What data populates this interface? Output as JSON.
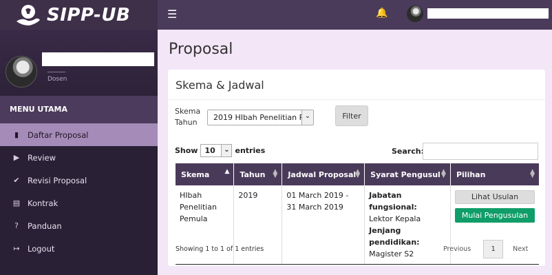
{
  "brand": {
    "name": "SIPP-UB",
    "logo_icon": "lightbulb-hand-icon"
  },
  "user": {
    "role": "Dosen"
  },
  "sidebar": {
    "menu_header": "MENU UTAMA",
    "items": [
      {
        "label": "Daftar Proposal",
        "icon": "book-icon",
        "active": true
      },
      {
        "label": "Review",
        "icon": "folder-open-icon"
      },
      {
        "label": "Revisi Proposal",
        "icon": "check-circle-icon"
      },
      {
        "label": "Kontrak",
        "icon": "file-icon"
      },
      {
        "label": "Panduan",
        "icon": "question-circle-icon"
      },
      {
        "label": "Logout",
        "icon": "sign-out-icon"
      }
    ]
  },
  "topbar": {
    "menu_icon": "hamburger-icon",
    "bell_icon": "bell-icon"
  },
  "page": {
    "title": "Proposal"
  },
  "panel": {
    "title": "Skema & Jadwal",
    "skema_label_line1": "Skema",
    "skema_label_line2": "Tahun",
    "skema_selected": "2019 HIbah Penelitian Pe",
    "filter_label": "Filter"
  },
  "table_controls": {
    "show_label": "Show",
    "length_value": "10",
    "entries_label": "entries",
    "search_label": "Search:"
  },
  "table": {
    "headers": [
      "Skema",
      "Tahun",
      "Jadwal Proposal",
      "Syarat Pengusul",
      "Pilihan"
    ],
    "rows": [
      {
        "skema": "HIbah Penelitian Pemula",
        "tahun": "2019",
        "jadwal": "01 March 2019 - 31 March 2019",
        "syarat_label_1": "Jabatan fungsional:",
        "syarat_value_1": "Lektor Kepala",
        "syarat_label_2": "Jenjang pendidikan:",
        "syarat_value_2": "Magister S2",
        "btn_lihat": "Lihat Usulan",
        "btn_mulai": "Mulai Pengusulan"
      }
    ]
  },
  "footer": {
    "info": "Showing 1 to 1 of 1 entries",
    "previous": "Previous",
    "page": "1",
    "next": "Next"
  },
  "colors": {
    "sidebar_bg": "#2a2035",
    "topbar_bg": "#4b3b5a",
    "active_item": "#a58bb8",
    "content_bg": "#f3e6f7",
    "primary_button": "#0f9d6a"
  }
}
